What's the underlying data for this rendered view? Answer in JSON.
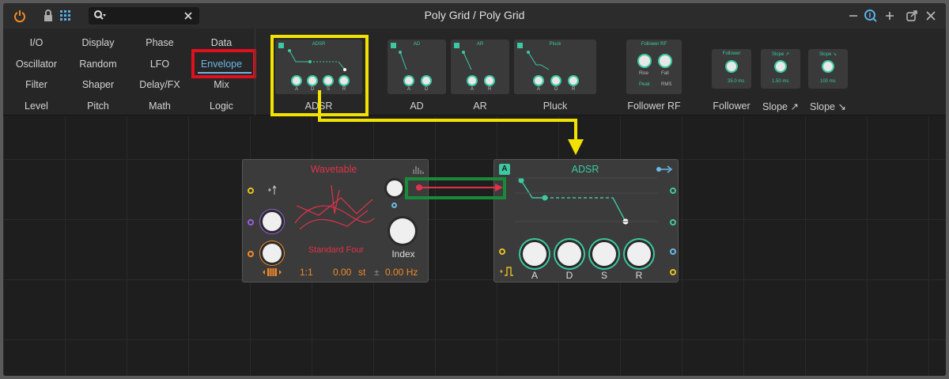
{
  "window": {
    "title": "Poly Grid / Poly Grid"
  },
  "categories": {
    "col1": [
      "I/O",
      "Oscillator",
      "Filter",
      "Level"
    ],
    "col2": [
      "Display",
      "Random",
      "Shaper",
      "Pitch"
    ],
    "col3": [
      "Phase",
      "LFO",
      "Delay/FX",
      "Math"
    ],
    "col4": [
      "Data",
      "Envelope",
      "Mix",
      "Logic"
    ]
  },
  "tiles": [
    {
      "name": "ADSR",
      "mini": "ADSR",
      "knobs": [
        "A",
        "D",
        "S",
        "R"
      ]
    },
    {
      "name": "AD",
      "mini": "AD",
      "knobs": [
        "A",
        "D"
      ]
    },
    {
      "name": "AR",
      "mini": "AR",
      "knobs": [
        "A",
        "R"
      ]
    },
    {
      "name": "Pluck",
      "mini": "Pluck",
      "knobs": [
        "A",
        "D",
        "R"
      ]
    },
    {
      "name": "Follower RF",
      "mini": "Follower RF",
      "knobs": [
        "Rise",
        "Fall"
      ],
      "extra": [
        "Peak",
        "RMS"
      ]
    },
    {
      "name": "Follower",
      "mini": "Follower",
      "value": "35.0 ms"
    },
    {
      "name": "Slope ↗",
      "mini": "Slope ↗",
      "value": "1.50 ms"
    },
    {
      "name": "Slope ↘",
      "mini": "Slope ↘",
      "value": "100 ms"
    }
  ],
  "wavetable": {
    "title": "Wavetable",
    "table_name": "Standard Four",
    "index_label": "Index",
    "ratio": "1:1",
    "semitones": "0.00",
    "semitones_unit": "st",
    "hz_prefix": "±",
    "hz": "0.00 Hz"
  },
  "adsr_module": {
    "badge": "A",
    "title": "ADSR",
    "knobs": [
      "A",
      "D",
      "S",
      "R"
    ]
  },
  "colors": {
    "accent_blue": "#6ab8e8",
    "teal": "#3cc8a0",
    "wavetable_red": "#e0324a",
    "orange": "#f08a28",
    "highlight_yellow": "#f2e200",
    "highlight_red": "#e0101e",
    "highlight_green": "#1a8a3a"
  }
}
